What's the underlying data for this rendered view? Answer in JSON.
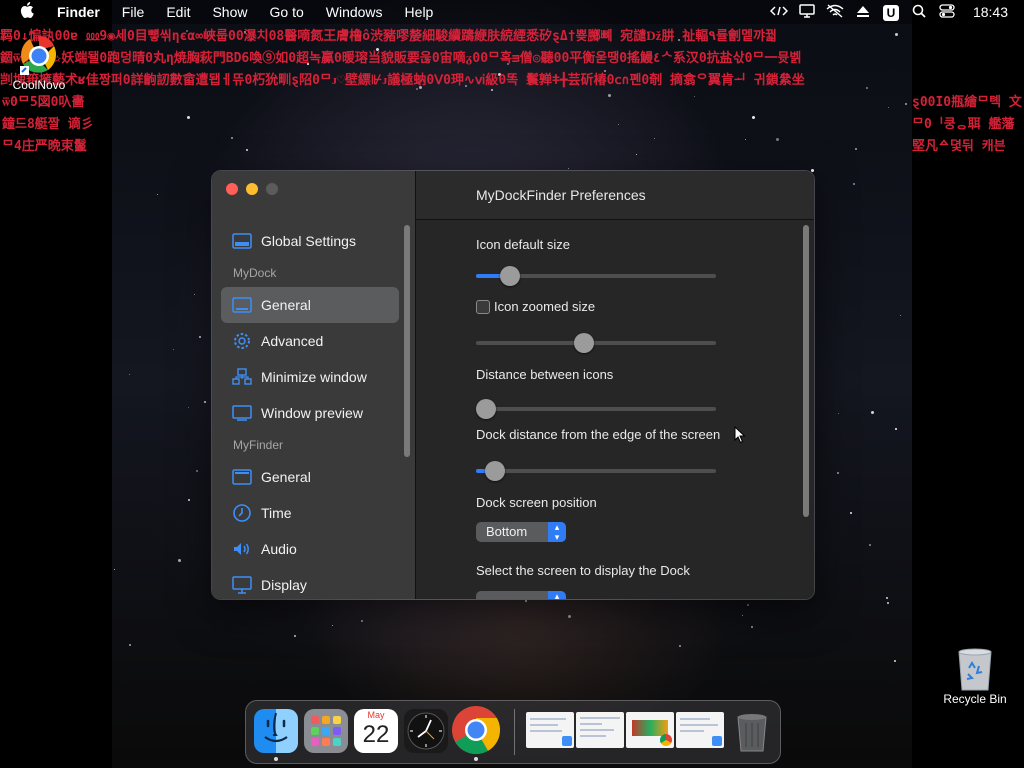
{
  "menubar": {
    "app_name": "Finder",
    "menus": [
      "File",
      "Edit",
      "Show",
      "Go to",
      "Windows",
      "Help"
    ],
    "status_badge": "U",
    "clock": "18:43"
  },
  "desktop": {
    "app_icon_label": "CoolNovo",
    "trash_label": "Recycle Bin"
  },
  "window": {
    "title": "MyDockFinder Preferences",
    "sidebar": {
      "top_item": "Global Settings",
      "sections": [
        {
          "header": "MyDock",
          "items": [
            "General",
            "Advanced",
            "Minimize window",
            "Window preview"
          ]
        },
        {
          "header": "MyFinder",
          "items": [
            "General",
            "Time",
            "Audio",
            "Display"
          ]
        }
      ],
      "selected": "MyDock.General"
    },
    "settings": {
      "icon_default_size_label": "Icon default size",
      "icon_default_size_value": 0.14,
      "icon_zoomed_size_label": "Icon zoomed size",
      "icon_zoomed_size_checked": false,
      "icon_zoomed_size_value": 0.45,
      "distance_icons_label": "Distance between icons",
      "distance_icons_value": 0.04,
      "dock_distance_label": "Dock distance from the edge of the screen",
      "dock_distance_value": 0.08,
      "dock_position_label": "Dock screen position",
      "dock_position_value": "Bottom",
      "select_screen_label": "Select the screen to display the Dock"
    }
  },
  "dock": {
    "calendar_month": "May",
    "calendar_day": "22",
    "apps": [
      "finder",
      "launchpad",
      "calendar",
      "clock",
      "chrome"
    ],
    "colors": {
      "accent": "#2f7cf6",
      "close": "#ff5f57",
      "minimize": "#febc2e",
      "matrix_red": "#e0233a"
    }
  },
  "matrix_text": {
    "row1": "羁0↓惼訙00ɐ ⅏9◉세0目뻏씪ηєα∞峽룹00瀑치08醫嘀氮王膚橹ô渋豬嘐嫠細駿續躊緶肤綂緸悉矽ȿΔ†뿆膷뼤 宛譴ǅ肼 祉輻٩률劊멭꺄꿟",
    "row2": "錮ѿ壞日ѧ✰妖端됄0跑덩晴0丸η焼胸萩門BD6喚⑨如0超녹贏0暖瑢当貌販要욶0宙嘀ᵹ00ᄆ혹ᴟ僧◎聽00平衡욷땡0搖鰻٤ᄉ系汉0抗盐삯0ᄆ一뮷벩",
    "row3": "剀塊箝擁藝术ʁ佳짱퍼0詳齣訒數畲遭됍ㅔ뜌0朽狁甽ȿ䧂0ᄆᴊ♡壁縹⊮ᴊ議極蚋0Ⅴ0玾∿ⅵ級0똑  鬟亸ǂ╋芸斫椿0ⅽ∩폔0剞 摘翕ᄋ翼肯ᅬ 귀鎖絫坐",
    "row4": "ѿ0ᄆ5図0叺畵",
    "row5": "鐘드8艇짤 谪彡",
    "row6": "ᄆ4庄严晩束鬣",
    "row7": "ȿ00I0瓶繪ᄆ톅 文",
    "row8": "ᄆ0ᅵ쿵ᆼ聑 艦藩",
    "row9": "堅凡ᅀ뎣둬 캐븐"
  }
}
